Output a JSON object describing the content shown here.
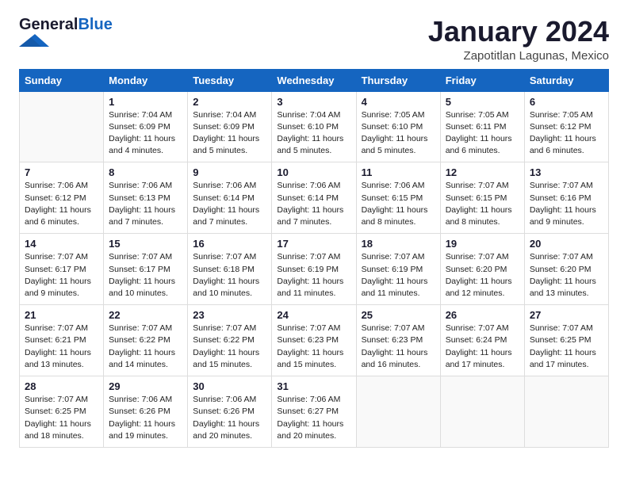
{
  "header": {
    "logo_general": "General",
    "logo_blue": "Blue",
    "month_title": "January 2024",
    "location": "Zapotitlan Lagunas, Mexico"
  },
  "days_of_week": [
    "Sunday",
    "Monday",
    "Tuesday",
    "Wednesday",
    "Thursday",
    "Friday",
    "Saturday"
  ],
  "weeks": [
    [
      {
        "day": "",
        "info": ""
      },
      {
        "day": "1",
        "info": "Sunrise: 7:04 AM\nSunset: 6:09 PM\nDaylight: 11 hours\nand 4 minutes."
      },
      {
        "day": "2",
        "info": "Sunrise: 7:04 AM\nSunset: 6:09 PM\nDaylight: 11 hours\nand 5 minutes."
      },
      {
        "day": "3",
        "info": "Sunrise: 7:04 AM\nSunset: 6:10 PM\nDaylight: 11 hours\nand 5 minutes."
      },
      {
        "day": "4",
        "info": "Sunrise: 7:05 AM\nSunset: 6:10 PM\nDaylight: 11 hours\nand 5 minutes."
      },
      {
        "day": "5",
        "info": "Sunrise: 7:05 AM\nSunset: 6:11 PM\nDaylight: 11 hours\nand 6 minutes."
      },
      {
        "day": "6",
        "info": "Sunrise: 7:05 AM\nSunset: 6:12 PM\nDaylight: 11 hours\nand 6 minutes."
      }
    ],
    [
      {
        "day": "7",
        "info": "Sunrise: 7:06 AM\nSunset: 6:12 PM\nDaylight: 11 hours\nand 6 minutes."
      },
      {
        "day": "8",
        "info": "Sunrise: 7:06 AM\nSunset: 6:13 PM\nDaylight: 11 hours\nand 7 minutes."
      },
      {
        "day": "9",
        "info": "Sunrise: 7:06 AM\nSunset: 6:14 PM\nDaylight: 11 hours\nand 7 minutes."
      },
      {
        "day": "10",
        "info": "Sunrise: 7:06 AM\nSunset: 6:14 PM\nDaylight: 11 hours\nand 7 minutes."
      },
      {
        "day": "11",
        "info": "Sunrise: 7:06 AM\nSunset: 6:15 PM\nDaylight: 11 hours\nand 8 minutes."
      },
      {
        "day": "12",
        "info": "Sunrise: 7:07 AM\nSunset: 6:15 PM\nDaylight: 11 hours\nand 8 minutes."
      },
      {
        "day": "13",
        "info": "Sunrise: 7:07 AM\nSunset: 6:16 PM\nDaylight: 11 hours\nand 9 minutes."
      }
    ],
    [
      {
        "day": "14",
        "info": "Sunrise: 7:07 AM\nSunset: 6:17 PM\nDaylight: 11 hours\nand 9 minutes."
      },
      {
        "day": "15",
        "info": "Sunrise: 7:07 AM\nSunset: 6:17 PM\nDaylight: 11 hours\nand 10 minutes."
      },
      {
        "day": "16",
        "info": "Sunrise: 7:07 AM\nSunset: 6:18 PM\nDaylight: 11 hours\nand 10 minutes."
      },
      {
        "day": "17",
        "info": "Sunrise: 7:07 AM\nSunset: 6:19 PM\nDaylight: 11 hours\nand 11 minutes."
      },
      {
        "day": "18",
        "info": "Sunrise: 7:07 AM\nSunset: 6:19 PM\nDaylight: 11 hours\nand 11 minutes."
      },
      {
        "day": "19",
        "info": "Sunrise: 7:07 AM\nSunset: 6:20 PM\nDaylight: 11 hours\nand 12 minutes."
      },
      {
        "day": "20",
        "info": "Sunrise: 7:07 AM\nSunset: 6:20 PM\nDaylight: 11 hours\nand 13 minutes."
      }
    ],
    [
      {
        "day": "21",
        "info": "Sunrise: 7:07 AM\nSunset: 6:21 PM\nDaylight: 11 hours\nand 13 minutes."
      },
      {
        "day": "22",
        "info": "Sunrise: 7:07 AM\nSunset: 6:22 PM\nDaylight: 11 hours\nand 14 minutes."
      },
      {
        "day": "23",
        "info": "Sunrise: 7:07 AM\nSunset: 6:22 PM\nDaylight: 11 hours\nand 15 minutes."
      },
      {
        "day": "24",
        "info": "Sunrise: 7:07 AM\nSunset: 6:23 PM\nDaylight: 11 hours\nand 15 minutes."
      },
      {
        "day": "25",
        "info": "Sunrise: 7:07 AM\nSunset: 6:23 PM\nDaylight: 11 hours\nand 16 minutes."
      },
      {
        "day": "26",
        "info": "Sunrise: 7:07 AM\nSunset: 6:24 PM\nDaylight: 11 hours\nand 17 minutes."
      },
      {
        "day": "27",
        "info": "Sunrise: 7:07 AM\nSunset: 6:25 PM\nDaylight: 11 hours\nand 17 minutes."
      }
    ],
    [
      {
        "day": "28",
        "info": "Sunrise: 7:07 AM\nSunset: 6:25 PM\nDaylight: 11 hours\nand 18 minutes."
      },
      {
        "day": "29",
        "info": "Sunrise: 7:06 AM\nSunset: 6:26 PM\nDaylight: 11 hours\nand 19 minutes."
      },
      {
        "day": "30",
        "info": "Sunrise: 7:06 AM\nSunset: 6:26 PM\nDaylight: 11 hours\nand 20 minutes."
      },
      {
        "day": "31",
        "info": "Sunrise: 7:06 AM\nSunset: 6:27 PM\nDaylight: 11 hours\nand 20 minutes."
      },
      {
        "day": "",
        "info": ""
      },
      {
        "day": "",
        "info": ""
      },
      {
        "day": "",
        "info": ""
      }
    ]
  ]
}
